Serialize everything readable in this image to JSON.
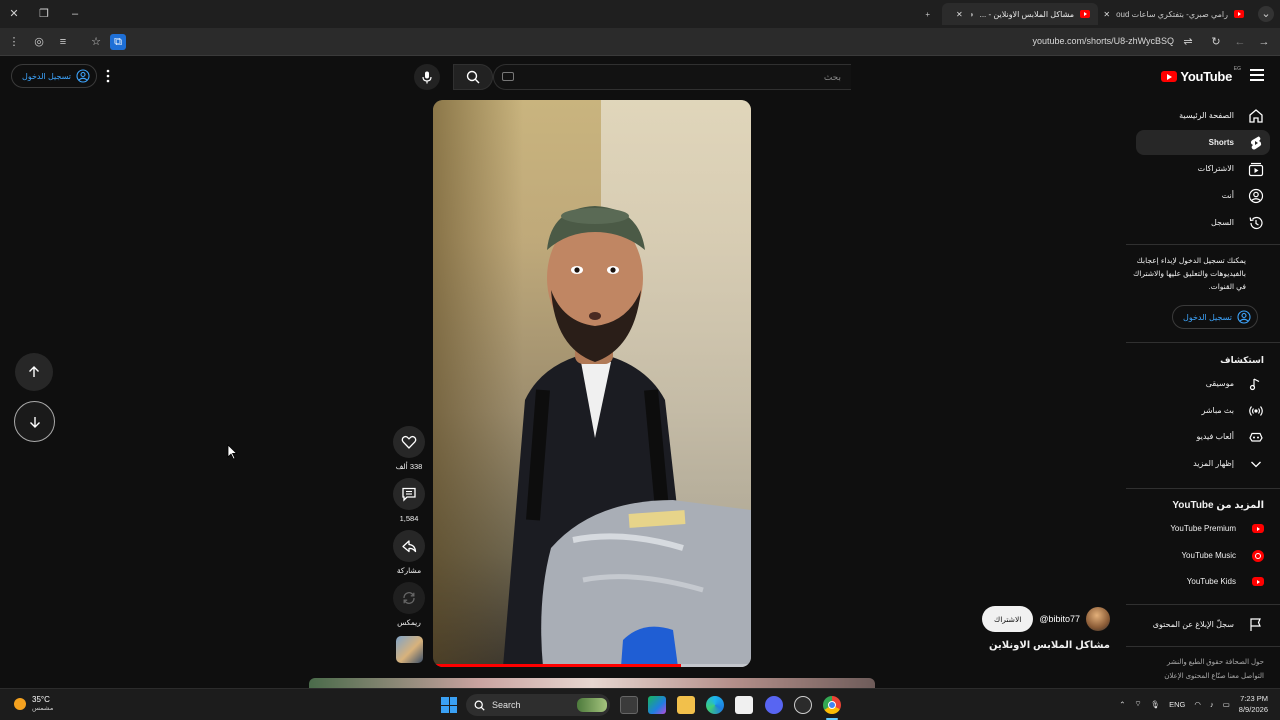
{
  "browser": {
    "tabs": [
      {
        "title": "رامي صبري- بتفتكري ساعات oud",
        "active": false
      },
      {
        "title": "مشاكل الملابس الاونلاين - ...",
        "active": true
      }
    ],
    "new_tab": "+",
    "url": "youtube.com/shorts/U8-zhWycBSQ"
  },
  "masthead": {
    "logo_text": "YouTube",
    "country_code": "EG",
    "search_placeholder": "بحث",
    "sign_in": "تسجيل الدخول"
  },
  "sidebar": {
    "primary": [
      {
        "label": "الصفحة الرئيسية",
        "icon": "home-icon",
        "active": false
      },
      {
        "label": "Shorts",
        "icon": "shorts-icon",
        "active": true
      },
      {
        "label": "الاشتراكات",
        "icon": "subscriptions-icon",
        "active": false
      },
      {
        "label": "أنت",
        "icon": "you-icon",
        "active": false
      },
      {
        "label": "السجل",
        "icon": "history-icon",
        "active": false
      }
    ],
    "signin_message": "يمكنك تسجيل الدخول لإبداء إعجابك بالفيديوهات والتعليق عليها والاشتراك في القنوات.",
    "signin_button": "تسجيل الدخول",
    "explore_title": "استكشاف",
    "explore": [
      {
        "label": "موسيقى",
        "icon": "music-icon"
      },
      {
        "label": "بث مباشر",
        "icon": "live-icon"
      },
      {
        "label": "ألعاب فيديو",
        "icon": "gaming-icon"
      },
      {
        "label": "إظهار المزيد",
        "icon": "chevron-down-icon"
      }
    ],
    "more_title_prefix": "المزيد من",
    "more_title_brand": "YouTube",
    "more": [
      {
        "label": "YouTube Premium",
        "icon": "youtube-premium-icon"
      },
      {
        "label": "YouTube Music",
        "icon": "youtube-music-icon"
      },
      {
        "label": "YouTube Kids",
        "icon": "youtube-kids-icon"
      }
    ],
    "report": {
      "label": "سجلّ الإبلاغ عن المحتوى",
      "icon": "flag-icon"
    },
    "footer": "حول  الصحافة  حقوق الطبع والنشر  التواصل معنا  صنّاع المحتوى  الإعلان"
  },
  "short": {
    "likes": "338 ألف",
    "comments": "1,584",
    "share": "مشاركة",
    "remix": "ريمكس",
    "channel_handle": "@bibito77",
    "subscribe": "الاشتراك",
    "title": "مشاكل الملابس الاونلاين",
    "progress_fraction": 0.78
  },
  "taskbar": {
    "temperature": "35°C",
    "weather": "مشمس",
    "search": "Search",
    "language": "ENG",
    "time": "7:23 PM",
    "date": "8/9/2026"
  }
}
